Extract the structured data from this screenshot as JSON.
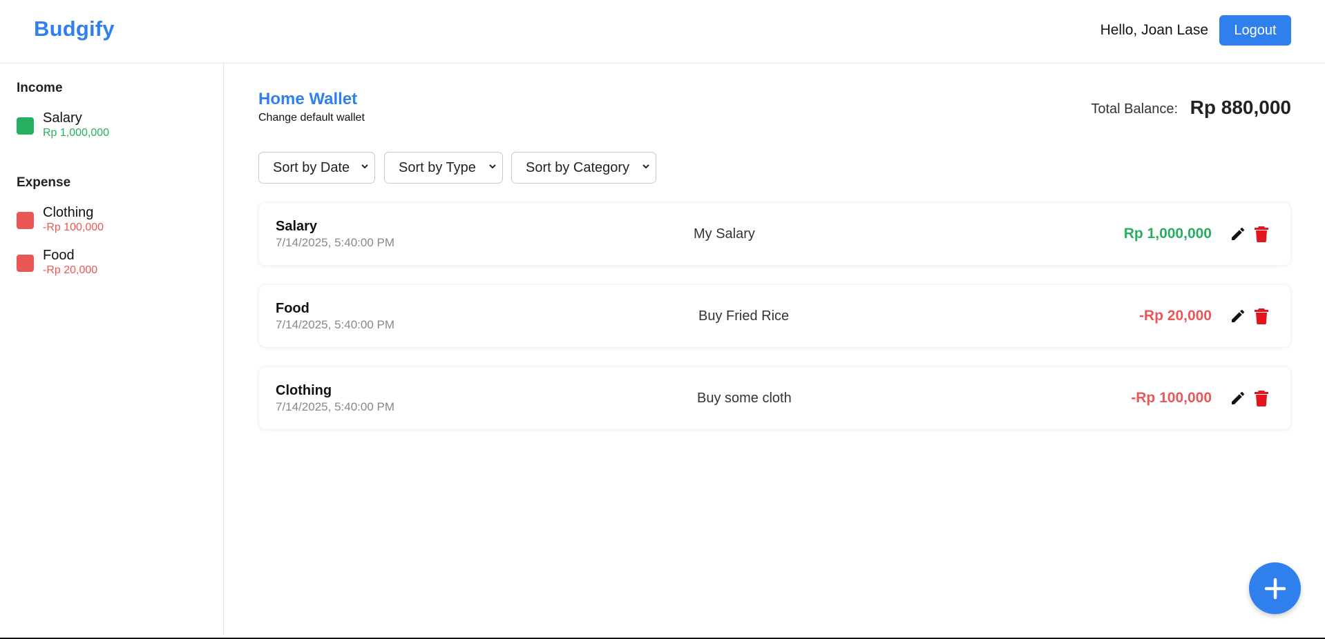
{
  "header": {
    "brand": "Budgify",
    "greeting": "Hello, Joan Lase",
    "logout_label": "Logout"
  },
  "sidebar": {
    "income_heading": "Income",
    "expense_heading": "Expense",
    "income_items": [
      {
        "name": "Salary",
        "amount": "Rp 1,000,000",
        "color": "#27ae60"
      }
    ],
    "expense_items": [
      {
        "name": "Clothing",
        "amount": "-Rp 100,000",
        "color": "#eb5757"
      },
      {
        "name": "Food",
        "amount": "-Rp 20,000",
        "color": "#eb5757"
      }
    ]
  },
  "wallet": {
    "title": "Home Wallet",
    "change_link": "Change default wallet",
    "balance_label": "Total Balance:",
    "balance_value": "Rp 880,000"
  },
  "filters": {
    "date": "Sort by Date",
    "type": "Sort by Type",
    "category": "Sort by Category"
  },
  "transactions": [
    {
      "category": "Salary",
      "date": "7/14/2025, 5:40:00 PM",
      "description": "My Salary",
      "amount": "Rp 1,000,000",
      "kind": "income"
    },
    {
      "category": "Food",
      "date": "7/14/2025, 5:40:00 PM",
      "description": "Buy Fried Rice",
      "amount": "-Rp 20,000",
      "kind": "expense"
    },
    {
      "category": "Clothing",
      "date": "7/14/2025, 5:40:00 PM",
      "description": "Buy some cloth",
      "amount": "-Rp 100,000",
      "kind": "expense"
    }
  ],
  "colors": {
    "accent": "#2f80ed",
    "income": "#27ae60",
    "expense": "#eb5757",
    "delete": "#e3141e"
  },
  "icons": {
    "edit": "pencil-icon",
    "delete": "trash-icon",
    "add": "plus-icon",
    "select": "chevron-down-icon"
  }
}
